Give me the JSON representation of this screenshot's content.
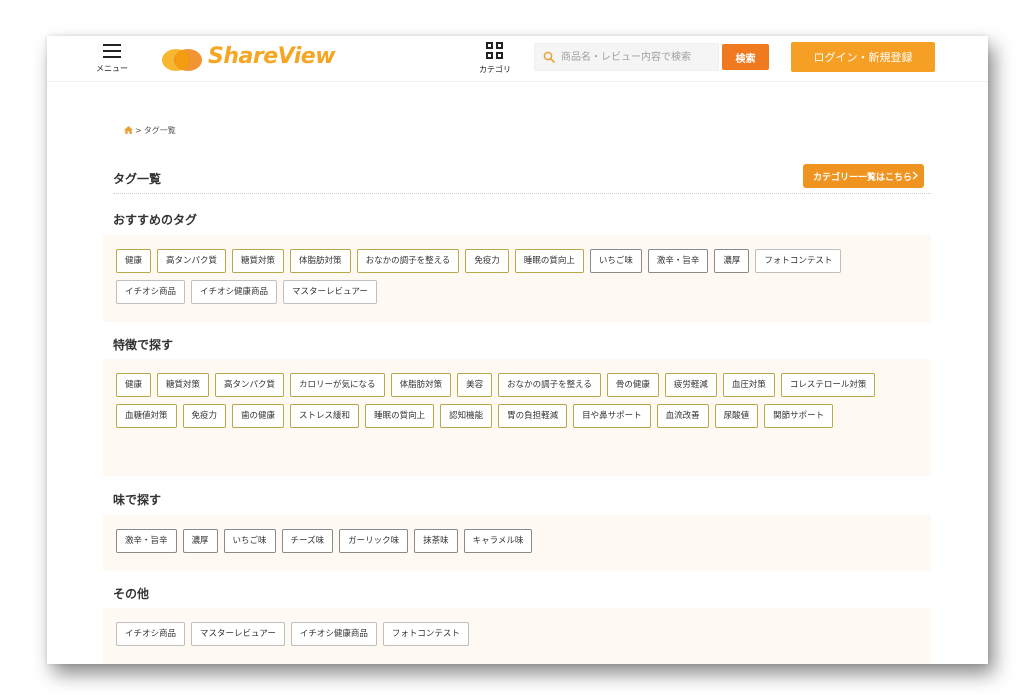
{
  "header": {
    "menu_label": "メニュー",
    "logo_text": "ShareView",
    "category_label": "カテゴリ",
    "search_placeholder": "商品名・レビュー内容で検索",
    "search_button": "検索",
    "login_button": "ログイン・新規登録",
    "colors": {
      "accent": "#f5a623",
      "search_button": "#f07a1f",
      "login_button": "#f5a025"
    }
  },
  "breadcrumb": {
    "home_icon": "home-icon",
    "separator": ">",
    "current": "タグ一覧"
  },
  "page": {
    "title": "タグ一覧",
    "category_list_button": "カテゴリー一覧はこちら"
  },
  "sections": {
    "recommended": {
      "title": "おすすめのタグ",
      "tags": [
        "健康",
        "高タンパク質",
        "糖質対策",
        "体脂肪対策",
        "おなかの調子を整える",
        "免疫力",
        "睡眠の質向上",
        "いちご味",
        "激辛・旨辛",
        "濃厚",
        "フォトコンテスト",
        "イチオシ商品",
        "イチオシ健康商品",
        "マスターレビュアー"
      ]
    },
    "features": {
      "title": "特徴で探す",
      "tags": [
        "健康",
        "糖質対策",
        "高タンパク質",
        "カロリーが気になる",
        "体脂肪対策",
        "美容",
        "おなかの調子を整える",
        "骨の健康",
        "疲労軽減",
        "血圧対策",
        "コレステロール対策",
        "血糖値対策",
        "免疫力",
        "歯の健康",
        "ストレス緩和",
        "睡眠の質向上",
        "認知機能",
        "胃の負担軽減",
        "目や鼻サポート",
        "血流改善",
        "尿酸値",
        "関節サポート"
      ]
    },
    "taste": {
      "title": "味で探す",
      "tags": [
        "激辛・旨辛",
        "濃厚",
        "いちご味",
        "チーズ味",
        "ガーリック味",
        "抹茶味",
        "キャラメル味"
      ]
    },
    "other": {
      "title": "その他",
      "tags": [
        "イチオシ商品",
        "マスターレビュアー",
        "イチオシ健康商品",
        "フォトコンテスト"
      ]
    }
  }
}
